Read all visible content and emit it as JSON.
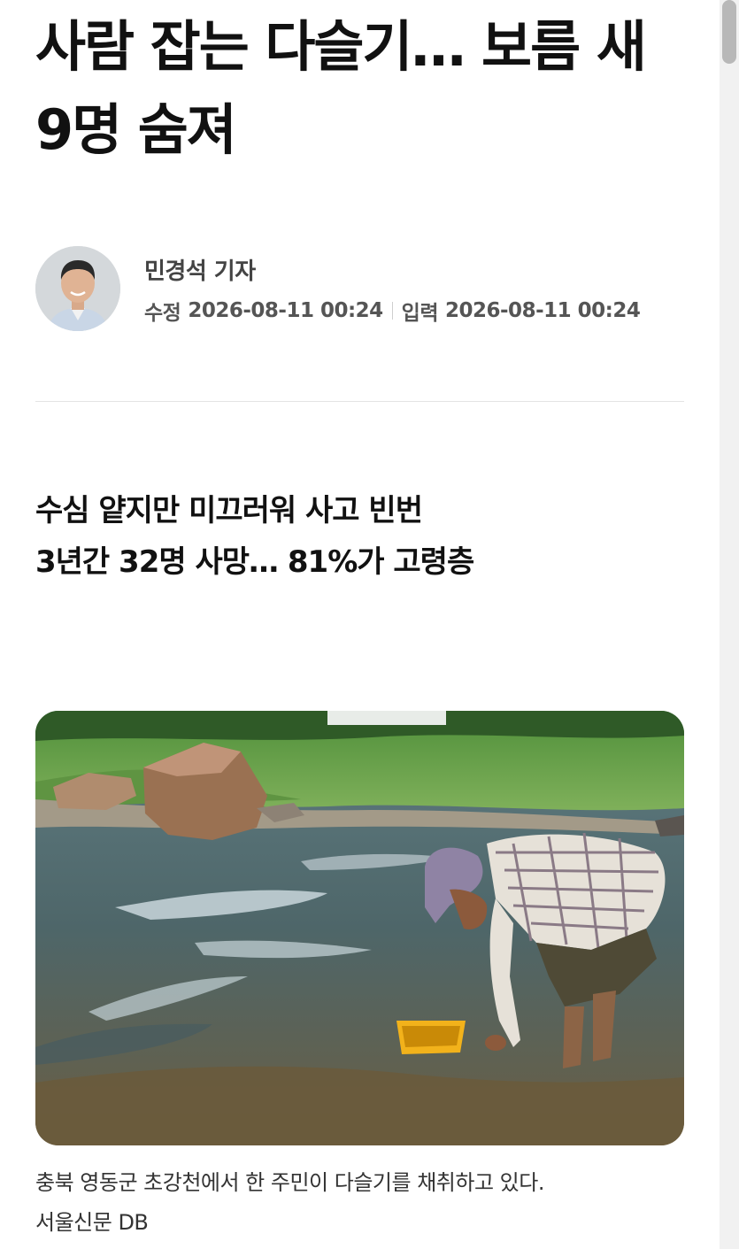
{
  "article": {
    "headline_line1": "사람 잡는 다슬기… 보름 새",
    "headline_line2": "9명 숨져",
    "author": {
      "name": "민경석 기자",
      "modified_label": "수정",
      "modified_time": "2026-08-11 00:24",
      "input_label": "입력",
      "input_time": "2026-08-11 00:24"
    },
    "subheadline": [
      "수심 얕지만 미끄러워 사고 빈번",
      "3년간 32명 사망… 81%가 고령층"
    ],
    "photo": {
      "caption": "충북 영동군 초강천에서 한 주민이 다슬기를 채취하고 있다.",
      "credit": "서울신문 DB"
    }
  }
}
